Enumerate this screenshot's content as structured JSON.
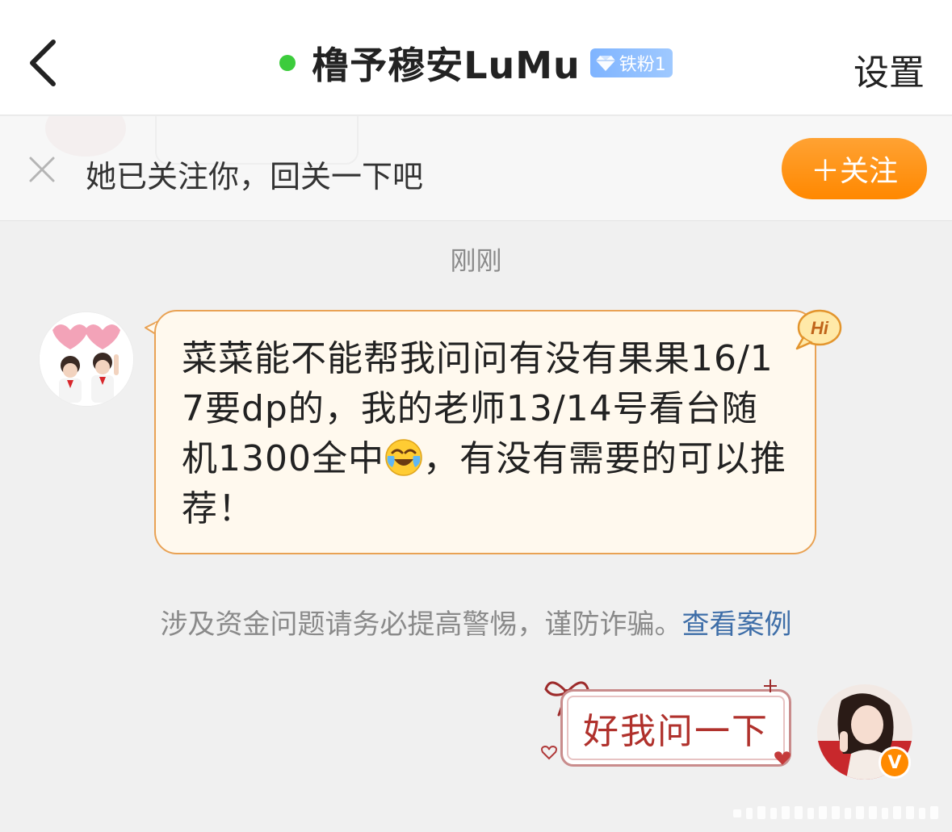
{
  "header": {
    "title": "橹予穆安LuMu",
    "badge": "铁粉1",
    "settings_label": "设置",
    "online_color": "#3ccc3c"
  },
  "follow_bar": {
    "text": "她已关注你，回关一下吧",
    "button_label": "＋关注",
    "button_color": "#ff9a1f"
  },
  "timestamp": "刚刚",
  "incoming": {
    "text_before_emoji": "菜菜能不能帮我问问有没有果果16/17要dp的，我的老师13/14号看台随机1300全中",
    "text_after_emoji": "，有没有需要的可以推荐！",
    "emoji": "laughing-crying-emoji",
    "hi_badge": "Hi"
  },
  "warning": {
    "text": "涉及资金问题请务必提高警惕，谨防诈骗。",
    "link": "查看案例"
  },
  "outgoing": {
    "text": "好我问一下",
    "verified_badge": "V"
  }
}
